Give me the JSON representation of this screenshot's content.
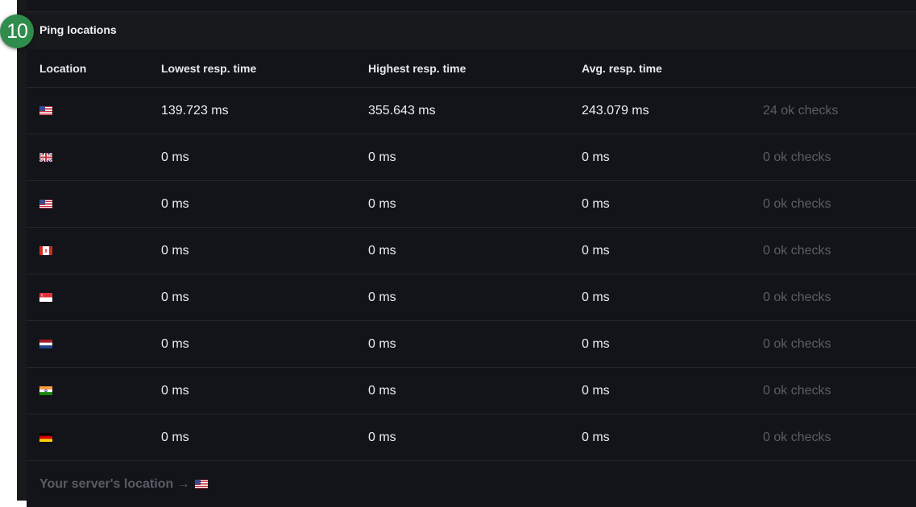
{
  "step_badge": "10",
  "section": {
    "title": "Ping locations"
  },
  "table": {
    "headers": [
      "Location",
      "Lowest resp. time",
      "Highest resp. time",
      "Avg. resp. time"
    ],
    "rows": [
      {
        "flag": "us-flag-icon",
        "lowest": "139.723 ms",
        "highest": "355.643 ms",
        "avg": "243.079 ms",
        "checks": "24 ok checks"
      },
      {
        "flag": "uk-flag-icon",
        "lowest": "0 ms",
        "highest": "0 ms",
        "avg": "0 ms",
        "checks": "0 ok checks"
      },
      {
        "flag": "us-flag-icon",
        "lowest": "0 ms",
        "highest": "0 ms",
        "avg": "0 ms",
        "checks": "0 ok checks"
      },
      {
        "flag": "canada-flag-icon",
        "lowest": "0 ms",
        "highest": "0 ms",
        "avg": "0 ms",
        "checks": "0 ok checks"
      },
      {
        "flag": "singapore-flag-icon",
        "lowest": "0 ms",
        "highest": "0 ms",
        "avg": "0 ms",
        "checks": "0 ok checks"
      },
      {
        "flag": "netherlands-flag-icon",
        "lowest": "0 ms",
        "highest": "0 ms",
        "avg": "0 ms",
        "checks": "0 ok checks"
      },
      {
        "flag": "india-flag-icon",
        "lowest": "0 ms",
        "highest": "0 ms",
        "avg": "0 ms",
        "checks": "0 ok checks"
      },
      {
        "flag": "germany-flag-icon",
        "lowest": "0 ms",
        "highest": "0 ms",
        "avg": "0 ms",
        "checks": "0 ok checks"
      }
    ]
  },
  "footer": {
    "label": "Your server's location →",
    "flag": "us-flag-icon"
  },
  "colors": {
    "badge": "#2f8c4c",
    "panel": "#18191d",
    "table": "#121419",
    "muted": "#5a5e66"
  }
}
